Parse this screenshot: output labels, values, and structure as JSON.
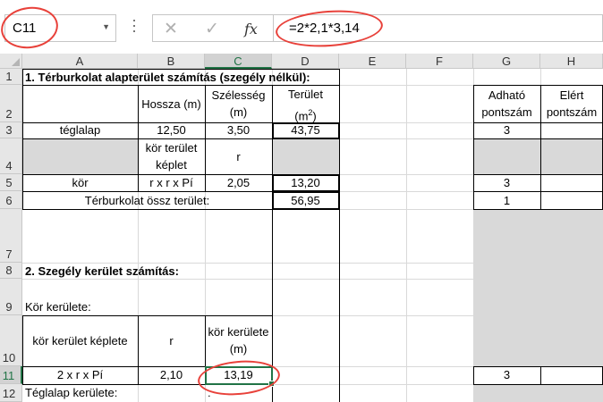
{
  "name_box": {
    "value": "C11"
  },
  "formula_bar": {
    "fx_label": "fx",
    "formula": "=2*2,1*3,14"
  },
  "columns": [
    "A",
    "B",
    "C",
    "D",
    "E",
    "F",
    "G",
    "H"
  ],
  "rows": [
    "1",
    "2",
    "3",
    "4",
    "5",
    "6",
    "7",
    "8",
    "9",
    "10",
    "11",
    "12"
  ],
  "cells": {
    "A1": "1. Térburkolat alapterület számítás (szegély nélkül):",
    "B2": "Hossza (m)",
    "C2_line1": "Szélesség",
    "C2_line2": "(m)",
    "D2_line1": "Terület",
    "D2_line2_base": "(m",
    "D2_line2_sup": "2",
    "D2_line2_end": ")",
    "G2_line1": "Adható",
    "G2_line2": "pontszám",
    "H2_line1": "Elért",
    "H2_line2": "pontszám",
    "A3": "téglalap",
    "B3": "12,50",
    "C3": "3,50",
    "D3": "43,75",
    "G3": "3",
    "B4_line1": "kör terület",
    "B4_line2": "képlet",
    "C4": "r",
    "A5": "kör",
    "B5": "r x r x Pí",
    "C5": "2,05",
    "D5": "13,20",
    "G5": "3",
    "A6": "Térburkolat össz terület:",
    "D6": "56,95",
    "G6": "1",
    "A8": "2. Szegély kerület számítás:",
    "A9": "Kör kerülete:",
    "A10": "kör kerület képlete",
    "B10": "r",
    "C10_line1": "kör kerülete",
    "C10_line2": "(m)",
    "A11": "2 x r x Pí",
    "B11": "2,10",
    "C11": "13,19",
    "G11": "3",
    "A12": "Téglalap kerülete:",
    "C12": ":"
  },
  "colors": {
    "selection": "#217346",
    "annotation": "#e8413a",
    "shaded": "#d9d9d9"
  }
}
